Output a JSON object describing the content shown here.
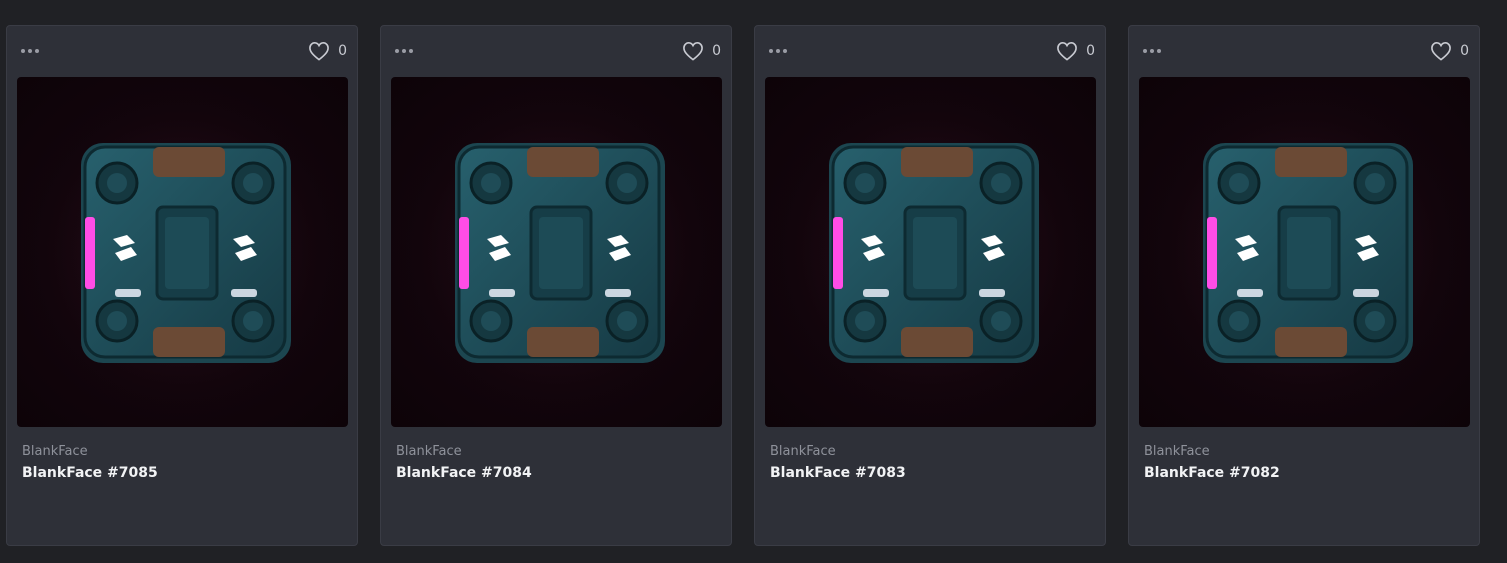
{
  "cards": [
    {
      "collection": "BlankFace",
      "name": "BlankFace #7085",
      "likes": "0"
    },
    {
      "collection": "BlankFace",
      "name": "BlankFace #7084",
      "likes": "0"
    },
    {
      "collection": "BlankFace",
      "name": "BlankFace #7083",
      "likes": "0"
    },
    {
      "collection": "BlankFace",
      "name": "BlankFace #7082",
      "likes": "0"
    }
  ],
  "icons": {
    "menu": "more-dots-icon",
    "like": "heart-outline-icon"
  },
  "colors": {
    "background": "#202125",
    "card": "#2e3038",
    "accent_magenta": "#ff4de6",
    "accent_orange": "#ff9a2e",
    "box_teal": "#1f4c57"
  }
}
